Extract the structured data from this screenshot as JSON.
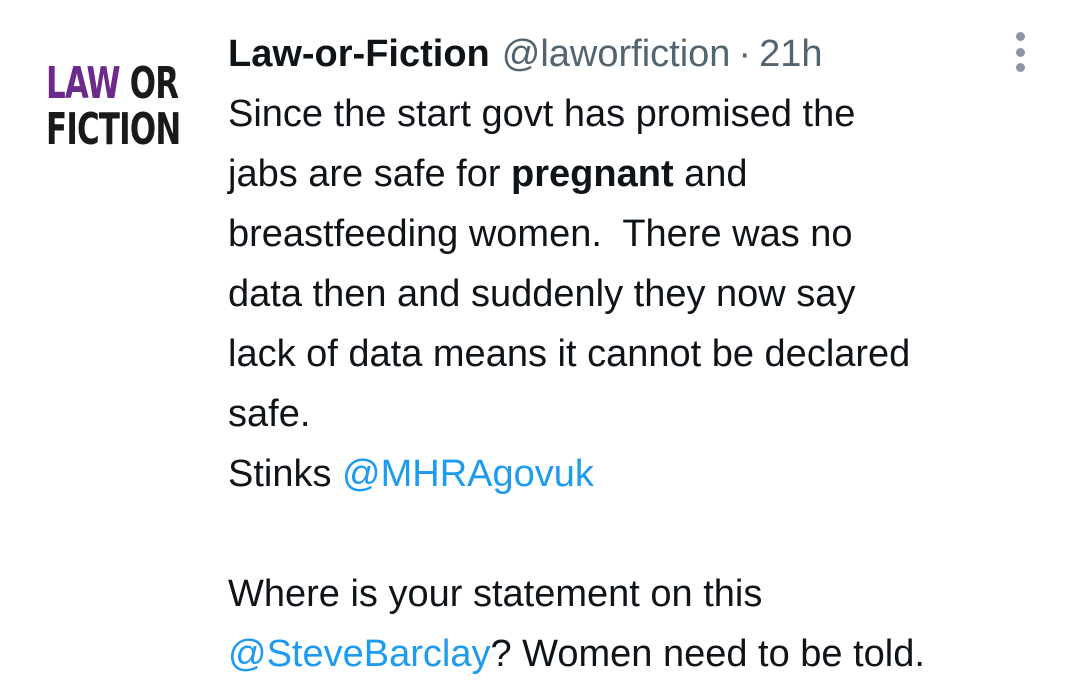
{
  "avatar": {
    "line1_word1": "LAW",
    "line1_word2": "OR",
    "line2": "FICTION"
  },
  "header": {
    "display_name": "Law-or-Fiction",
    "handle": "@laworfiction",
    "separator": "·",
    "time": "21h"
  },
  "more_menu": {
    "icon": "vertical-ellipsis-icon"
  },
  "body": {
    "line1": "Since the start govt has promised the",
    "line2_pre": "jabs are safe for ",
    "line2_bold": "pregnant",
    "line2_post": " and",
    "line3": "breastfeeding women.  There was no",
    "line4": "data then and suddenly they now say",
    "line5": "lack of data means it cannot be declared",
    "line6": "safe.",
    "line7_pre": "Stinks ",
    "mention1": "@MHRAgovuk",
    "line8": "Where is your statement on this",
    "mention2": "@SteveBarclay",
    "line9_post": "? Women need to be told."
  },
  "colors": {
    "link": "#1d9bf0",
    "secondary_text": "#536471",
    "primary_text": "#0f1419",
    "logo_purple": "#6b2a8c"
  }
}
